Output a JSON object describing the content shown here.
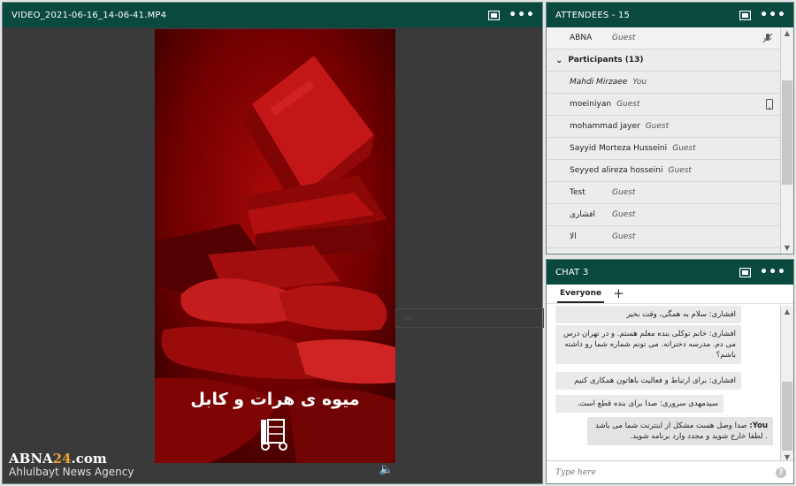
{
  "video_pod": {
    "title": "VIDEO_2021-06-16_14-06-41.MP4",
    "caption": "میوه ی هرات و کابل",
    "overlay_text": "",
    "speaker_icon": "speaker-icon"
  },
  "attendees_pod": {
    "title": "ATTENDEES - 15",
    "host": {
      "name": "ABNA",
      "role": "Guest"
    },
    "group_label": "Participants (13)",
    "participants": [
      {
        "name": "Mahdi Mirzaee",
        "role": "You"
      },
      {
        "name": "moeiniyan",
        "role": "Guest"
      },
      {
        "name": "mohammad jayer",
        "role": "Guest"
      },
      {
        "name": "Sayyid Morteza Husseini",
        "role": "Guest"
      },
      {
        "name": "Seyyed alireza hosseini",
        "role": "Guest"
      },
      {
        "name": "Test",
        "role": "Guest"
      },
      {
        "name": "افشاری",
        "role": "Guest"
      },
      {
        "name": "الا",
        "role": "Guest"
      }
    ]
  },
  "chat_pod": {
    "title": "CHAT 3",
    "tab_label": "Everyone",
    "messages": [
      {
        "text": "افشاری: سلام به همگی، وقت بخیر"
      },
      {
        "text": "افشاری: خانم توکلی بنده معلم هستم. و در تهران درس می دم. مدرسه دخترانه. می تونم شماره شما رو داشته باشم؟"
      },
      {
        "text": "افشاری: برای ارتباط و فعالیت باهاتون همکاری کنیم"
      },
      {
        "text": "سیدمهدی سروری: صدا برای بنده قطع است."
      },
      {
        "sender": "You:",
        "text": "صدا وصل هست مشکل از اینترنت شما می باشد . لطفا خارج شوید و مجدد وارد برنامه شوید."
      }
    ],
    "input_placeholder": "Type here"
  },
  "watermark": {
    "logo_main": "ABNA",
    "logo_accent": "24",
    "logo_suffix": ".com",
    "agency": "Ahlulbayt News Agency"
  }
}
